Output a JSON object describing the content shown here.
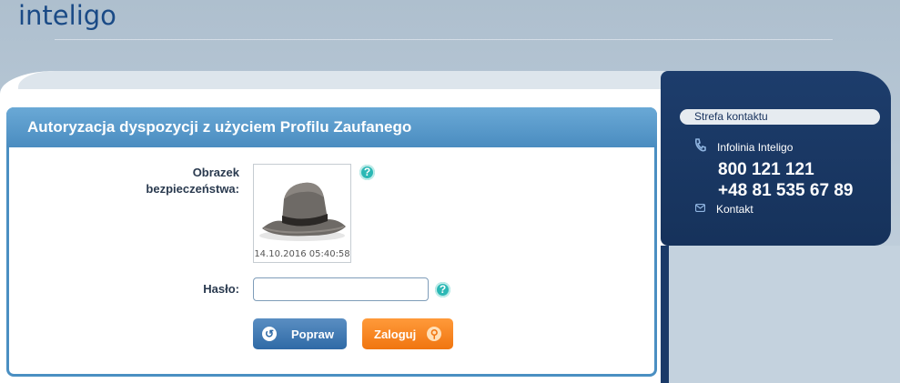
{
  "brand": {
    "logo_text": "inteligo"
  },
  "header": {
    "title": "Autoryzacja dyspozycji z użyciem Profilu Zaufanego"
  },
  "form": {
    "security_image_label": "Obrazek bezpieczeństwa:",
    "security_image_timestamp": "14.10.2016 05:40:58",
    "password_label": "Hasło:",
    "password_value": "",
    "fix_button": "Popraw",
    "login_button": "Zaloguj"
  },
  "contact": {
    "title": "Strefa kontaktu",
    "hotline_label": "Infolinia Inteligo",
    "phone1": "800 121 121",
    "phone2": "+48 81 535 67 89",
    "contact_link": "Kontakt"
  },
  "colors": {
    "accent": "#4a8cc0",
    "login": "#f07510",
    "dark_panel": "#1d3d6c",
    "help": "#2bb8b5"
  },
  "icons": {
    "help": "question-circle-icon",
    "fix": "back-arrow-icon",
    "login": "key-icon",
    "hotline": "phone-icon",
    "mail": "envelope-icon"
  }
}
